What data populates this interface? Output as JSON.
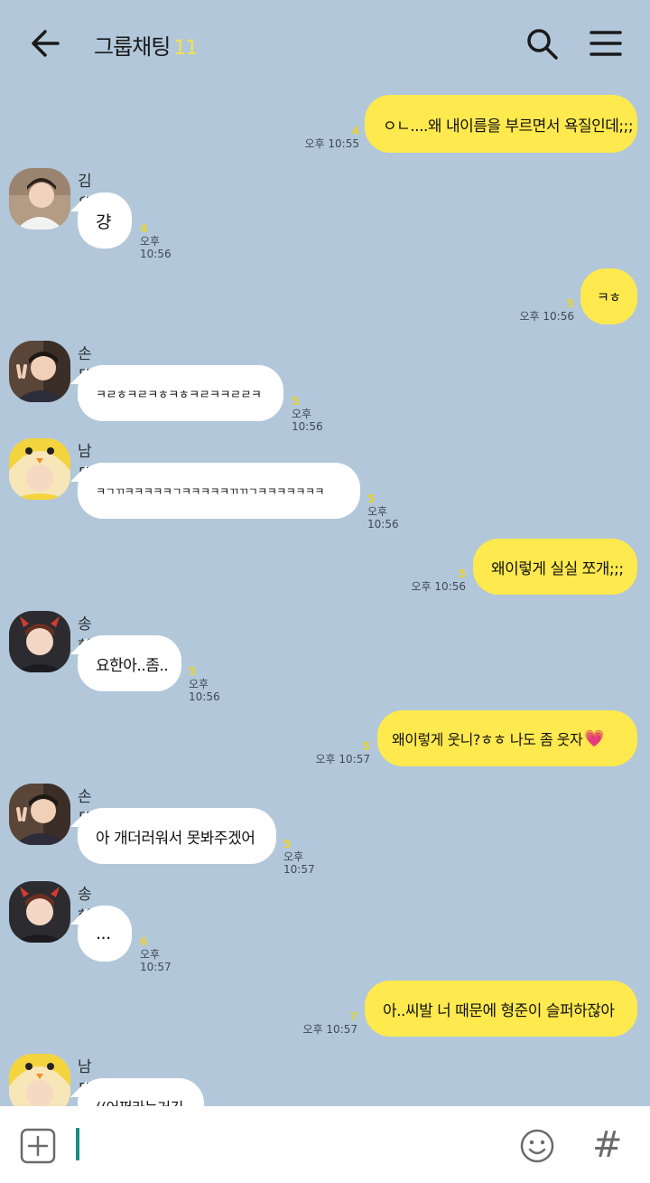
{
  "header": {
    "title": "그룹채팅",
    "member_count": "11"
  },
  "messages": [
    {
      "side": "me",
      "text": "ㅇㄴ....왜 내이름을 부르면서 욕질인데;;;",
      "unread": "4",
      "time": "오후 10:55"
    },
    {
      "side": "other",
      "sender": "김우석",
      "text": "걍",
      "unread": "4",
      "time": "오후 10:56",
      "avatar": "hoodie-boy"
    },
    {
      "side": "me",
      "text": "ㅋㅎ",
      "unread": "5",
      "time": "오후 10:56"
    },
    {
      "side": "other",
      "sender": "손동표",
      "text": "ㅋㄹㅎㅋㄹㅋㅎㅋㅎㅋㄹㅋㅋㄹㄹㅋ",
      "unread": "5",
      "time": "오후 10:56",
      "avatar": "peace-sign"
    },
    {
      "side": "other",
      "sender": "남도현",
      "text": "ㅋㄱㄲㅋㅋㅋㅋㅋㄱㅋㅋㅋㅋㅋㄲㄲㄱㅋㅋㅋㅋㅋㅋㅋ",
      "unread": "5",
      "time": "오후 10:56",
      "avatar": "chick-hat"
    },
    {
      "side": "me",
      "text": "왜이렇게 실실 쪼개;;;",
      "unread": "5",
      "time": "오후 10:56"
    },
    {
      "side": "other",
      "sender": "송형준",
      "text": "요한아..좀..",
      "unread": "5",
      "time": "오후 10:56",
      "avatar": "devil-horns"
    },
    {
      "side": "me",
      "text": "왜이렇게 웃니?ㅎㅎ 나도 좀 웃자",
      "emoji": "💗",
      "unread": "5",
      "time": "오후 10:57"
    },
    {
      "side": "other",
      "sender": "손동표",
      "text": "아 개더러워서 못봐주겠어",
      "unread": "5",
      "time": "오후 10:57",
      "avatar": "peace-sign"
    },
    {
      "side": "other",
      "sender": "송형준",
      "text": "...",
      "unread": "6",
      "time": "오후 10:57",
      "avatar": "devil-horns"
    },
    {
      "side": "me",
      "text": "아..씨발 너 때문에 형준이 슬퍼하잖아",
      "unread": "7",
      "time": "오후 10:57"
    },
    {
      "side": "other",
      "sender": "남도현",
      "text": "((어쩌라는거긴",
      "avatar": "chick-hat"
    }
  ],
  "input": {
    "placeholder": ""
  },
  "colors": {
    "background": "#b2c7da",
    "my_bubble": "#fee94e",
    "other_bubble": "#ffffff",
    "unread": "#e8d330",
    "cursor": "#1d8c84"
  },
  "icons": [
    "back-arrow-icon",
    "search-icon",
    "menu-icon",
    "plus-icon",
    "emoji-icon",
    "hash-icon"
  ]
}
